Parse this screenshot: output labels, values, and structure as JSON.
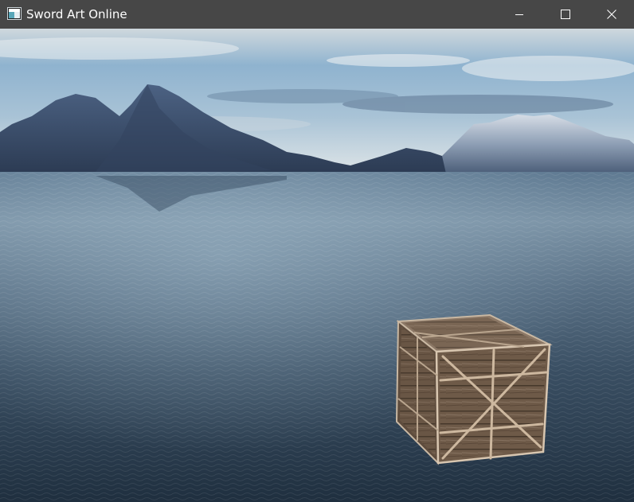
{
  "window": {
    "title": "Sword Art Online",
    "controls": {
      "minimize_icon": "minimize-icon",
      "maximize_icon": "maximize-icon",
      "close_icon": "close-icon"
    }
  },
  "scene": {
    "description_icons": [
      "app-icon"
    ],
    "colors": {
      "sky_top": "#6f9cc2",
      "sky_horizon": "#d9e2e6",
      "mountain": "#3b4e6a",
      "water_near": "#283a4c",
      "water_far": "#7e98ae",
      "crate": "#7a6652"
    }
  }
}
